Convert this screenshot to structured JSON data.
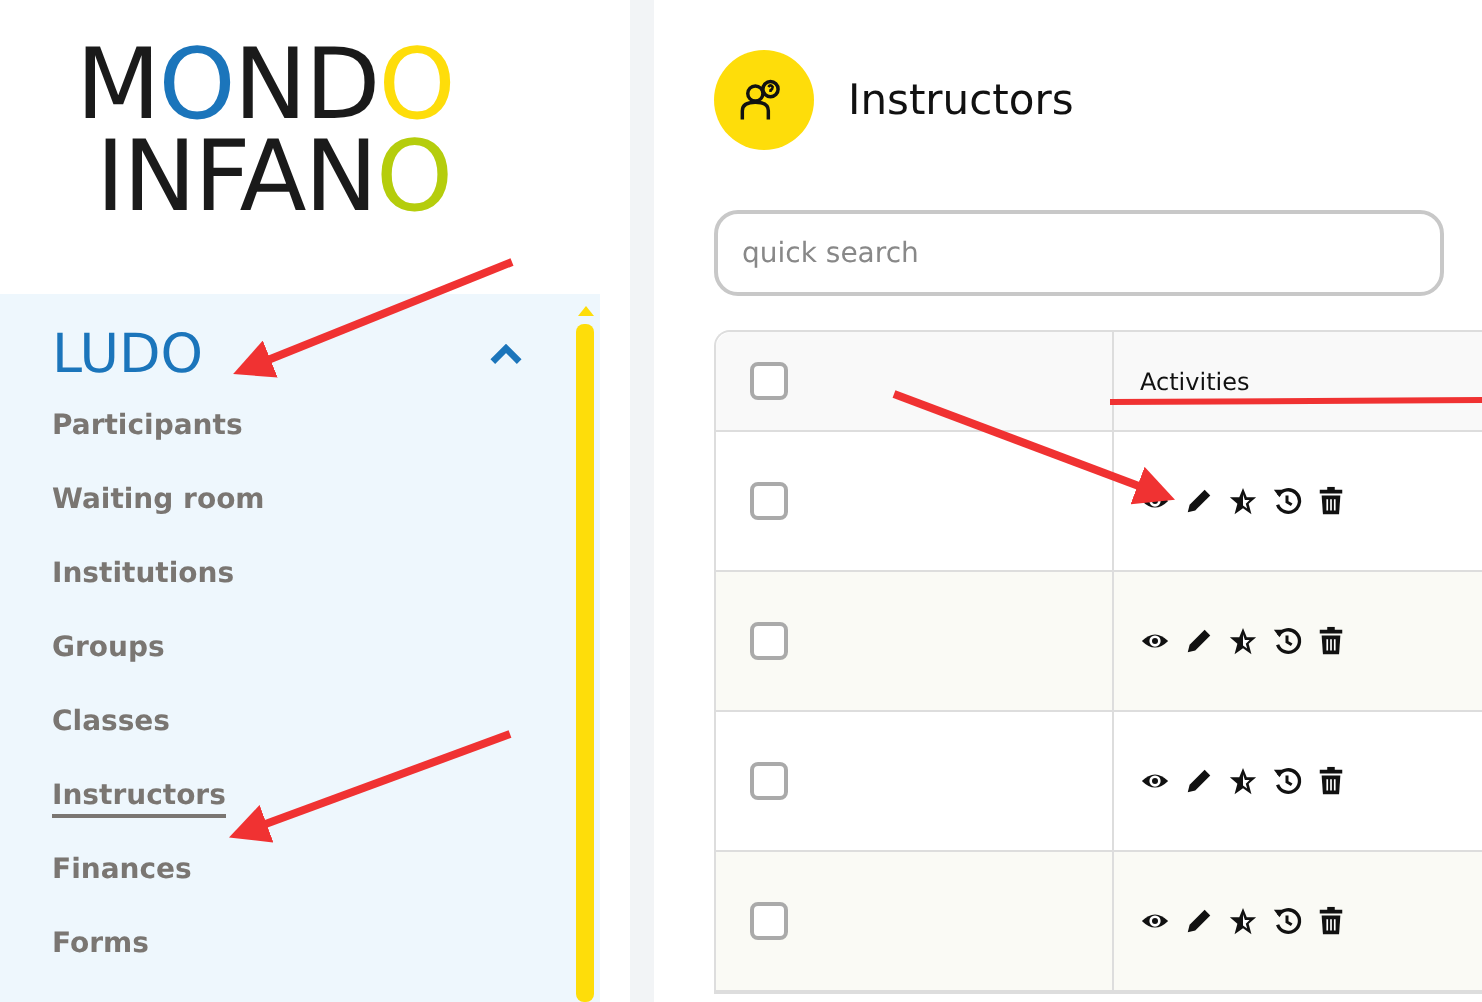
{
  "logo": {
    "lines": [
      [
        {
          "text": "M"
        },
        {
          "text": "O",
          "color": "#1b75bb"
        },
        {
          "text": "ND"
        },
        {
          "text": "O",
          "color": "#fedd0a"
        }
      ],
      [
        {
          "text": "INFAN"
        },
        {
          "text": "O",
          "color": "#b5cd0c"
        }
      ]
    ]
  },
  "sidebar": {
    "section": {
      "title": "LUDO",
      "expanded": true
    },
    "items": [
      {
        "label": "Participants",
        "selected": false
      },
      {
        "label": "Waiting room",
        "selected": false
      },
      {
        "label": "Institutions",
        "selected": false
      },
      {
        "label": "Groups",
        "selected": false
      },
      {
        "label": "Classes",
        "selected": false
      },
      {
        "label": "Instructors",
        "selected": true
      },
      {
        "label": "Finances",
        "selected": false
      },
      {
        "label": "Forms",
        "selected": false
      }
    ]
  },
  "page": {
    "title": "Instructors"
  },
  "search": {
    "placeholder": "quick search"
  },
  "table": {
    "header_checked": false,
    "columns": [
      "Activities"
    ],
    "rows": [
      {
        "checked": false
      },
      {
        "checked": false
      },
      {
        "checked": false
      },
      {
        "checked": false
      }
    ]
  }
}
